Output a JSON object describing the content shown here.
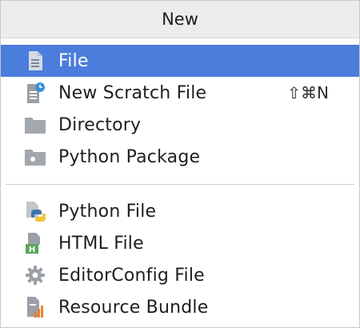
{
  "header": {
    "title": "New"
  },
  "menu": {
    "group1": [
      {
        "label": "File",
        "icon": "file-icon",
        "selected": true
      },
      {
        "label": "New Scratch File",
        "icon": "scratch-file-icon",
        "shortcut": "⇧⌘N"
      },
      {
        "label": "Directory",
        "icon": "folder-icon"
      },
      {
        "label": "Python Package",
        "icon": "package-folder-icon"
      }
    ],
    "group2": [
      {
        "label": "Python File",
        "icon": "python-file-icon"
      },
      {
        "label": "HTML File",
        "icon": "html-file-icon"
      },
      {
        "label": "EditorConfig File",
        "icon": "gear-icon"
      },
      {
        "label": "Resource Bundle",
        "icon": "resource-bundle-icon"
      }
    ]
  },
  "colors": {
    "selection": "#4a7ddc",
    "header_bg": "#ececec",
    "icon_gray": "#8b8f94",
    "clock_blue": "#3d8fd8",
    "python_blue": "#3d74b0",
    "python_yellow": "#f4c33a",
    "html_green": "#5aa55a",
    "bundle_orange": "#e8822e"
  }
}
